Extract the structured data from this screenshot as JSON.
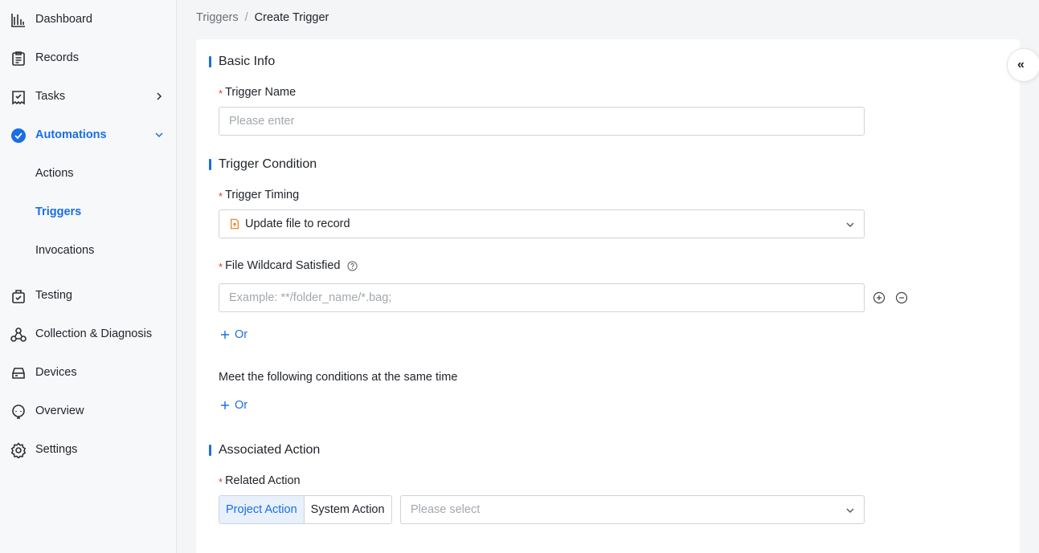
{
  "sidebar": {
    "items": [
      {
        "label": "Dashboard"
      },
      {
        "label": "Records"
      },
      {
        "label": "Tasks"
      },
      {
        "label": "Automations"
      },
      {
        "label": "Actions"
      },
      {
        "label": "Triggers"
      },
      {
        "label": "Invocations"
      },
      {
        "label": "Testing"
      },
      {
        "label": "Collection & Diagnosis"
      },
      {
        "label": "Devices"
      },
      {
        "label": "Overview"
      },
      {
        "label": "Settings"
      }
    ]
  },
  "breadcrumb": {
    "parent": "Triggers",
    "separator": "/",
    "current": "Create Trigger"
  },
  "form": {
    "basic_info": {
      "title": "Basic Info",
      "trigger_name_label": "Trigger Name",
      "trigger_name_placeholder": "Please enter"
    },
    "trigger_condition": {
      "title": "Trigger Condition",
      "timing_label": "Trigger Timing",
      "timing_value": "Update file to record",
      "wildcard_label": "File Wildcard Satisfied",
      "wildcard_placeholder": "Example: **/folder_name/*.bag;",
      "or_label": "Or",
      "meet_conditions_text": "Meet the following conditions at the same time",
      "or_label_2": "Or"
    },
    "associated_action": {
      "title": "Associated Action",
      "related_action_label": "Related Action",
      "project_action": "Project Action",
      "system_action": "System Action",
      "select_placeholder": "Please select"
    }
  },
  "colors": {
    "accent": "#1a6ee6",
    "required": "#ee3333",
    "sidebar_bg": "#f7f8fa",
    "page_bg": "#f4f5f7"
  },
  "required_marker": "*",
  "collapse_icon_text": "«"
}
